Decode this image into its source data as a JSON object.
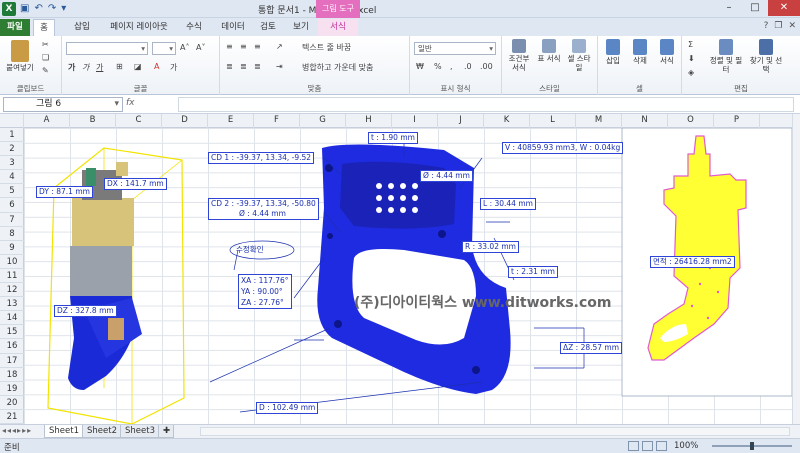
{
  "window": {
    "title": "통합 문서1 - Microsoft Excel",
    "context_tab": "그림 도구",
    "qat_icons": [
      "excel-logo",
      "save-icon",
      "undo-icon",
      "redo-icon"
    ]
  },
  "tabs": [
    {
      "label": "파일",
      "kind": "file"
    },
    {
      "label": "홈",
      "kind": "active"
    },
    {
      "label": "삽입"
    },
    {
      "label": "페이지 레이아웃"
    },
    {
      "label": "수식"
    },
    {
      "label": "데이터"
    },
    {
      "label": "검토"
    },
    {
      "label": "보기"
    },
    {
      "label": "서식",
      "kind": "format"
    }
  ],
  "ribbon": {
    "clipboard": {
      "group": "클립보드",
      "paste": "붙여넣기"
    },
    "font": {
      "group": "글꼴",
      "bold": "가",
      "italic": "가",
      "underline": "가"
    },
    "alignment": {
      "group": "맞춤",
      "wrap": "텍스트 줄 바꿈",
      "merge": "병합하고 가운데 맞춤"
    },
    "number": {
      "group": "표시 형식",
      "format": "일반",
      "percent": "%"
    },
    "styles": {
      "group": "스타일",
      "conditional": "조건부 서식",
      "table": "표 서식",
      "cell": "셀 스타일"
    },
    "cells": {
      "group": "셀",
      "insert": "삽입",
      "delete": "삭제",
      "format": "서식"
    },
    "editing": {
      "group": "편집",
      "sort": "정렬 및 필터",
      "find": "찾기 및 선택"
    }
  },
  "formula_bar": {
    "name_box": "그림 6",
    "fx": "fx"
  },
  "columns": [
    "A",
    "B",
    "C",
    "D",
    "E",
    "F",
    "G",
    "H",
    "I",
    "J",
    "K",
    "L",
    "M",
    "N",
    "O",
    "P"
  ],
  "rows": [
    "1",
    "2",
    "3",
    "4",
    "5",
    "6",
    "7",
    "8",
    "9",
    "10",
    "11",
    "12",
    "13",
    "14",
    "15",
    "16",
    "17",
    "18",
    "19",
    "20",
    "21"
  ],
  "annotations": {
    "pump": {
      "dx": "DX : 141.7 mm",
      "dy": "DY : 87.1 mm",
      "dz": "DZ : 327.8 mm"
    },
    "handle": {
      "t1": "t : 1.90 mm",
      "cd1": "CD 1 : -39.37, 13.34, -9.52",
      "cd2_a": "CD 2 : -39.37, 13.34, -50.80",
      "cd2_b": "Ø : 4.44 mm",
      "dia": "Ø : 4.44 mm",
      "vol": "V : 40859.93 mm3, W : 0.04kg",
      "l": "L : 30.44 mm",
      "r": "R : 33.02 mm",
      "t2": "t : 2.31 mm",
      "edit": "수정확인",
      "xa": "XA : 117.76°",
      "ya": "YA : 90.00°",
      "za": "ZA : 27.76°",
      "dz": "ΔZ : 28.57 mm",
      "d": "D : 102.49 mm"
    },
    "profile": {
      "area": "면적 : 26416.28 mm2"
    },
    "watermark": "(주)디아이티웍스 www.ditworks.com"
  },
  "sheets": [
    "Sheet1",
    "Sheet2",
    "Sheet3"
  ],
  "status": {
    "ready": "준비",
    "zoom": "100%"
  }
}
